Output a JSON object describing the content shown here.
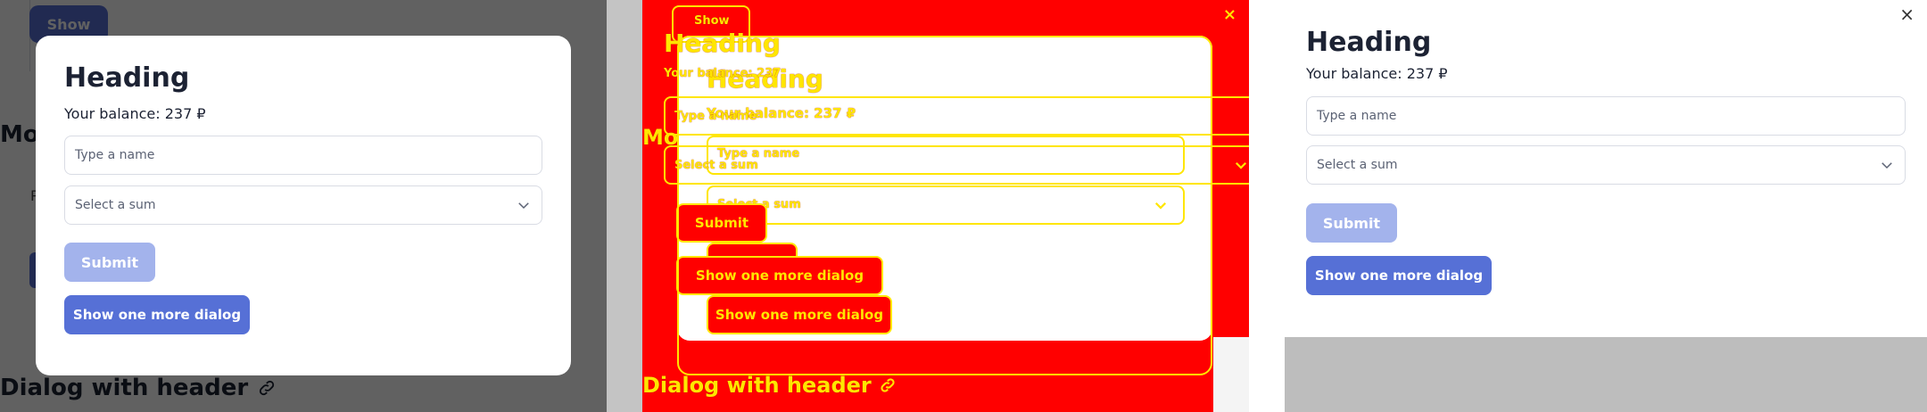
{
  "dialog": {
    "heading": "Heading",
    "balance": "Your balance: 237 ₽",
    "name_placeholder": "Type a name",
    "sum_placeholder": "Select a sum",
    "submit_label": "Submit",
    "more_label": "Show one more dialog"
  },
  "background": {
    "show_label": "Show",
    "section_partial": "Mo",
    "tab_partial": "P",
    "dialog_header_title": "Dialog with header"
  },
  "diff": {
    "close_glyph": "×",
    "misc_ghost": "Your balance: 237",
    "mo_ghost": "Mo"
  },
  "close_glyph": "×",
  "colors": {
    "primary": "#5670d6",
    "primary_disabled": "#a3b3ec",
    "overlay": "rgba(0,0,0,0.62)",
    "diff_red": "#ff0000",
    "diff_yellow": "#ffe600"
  },
  "icons": {
    "chevron": "chevron-down-icon",
    "link": "link-icon",
    "close": "close-icon"
  }
}
